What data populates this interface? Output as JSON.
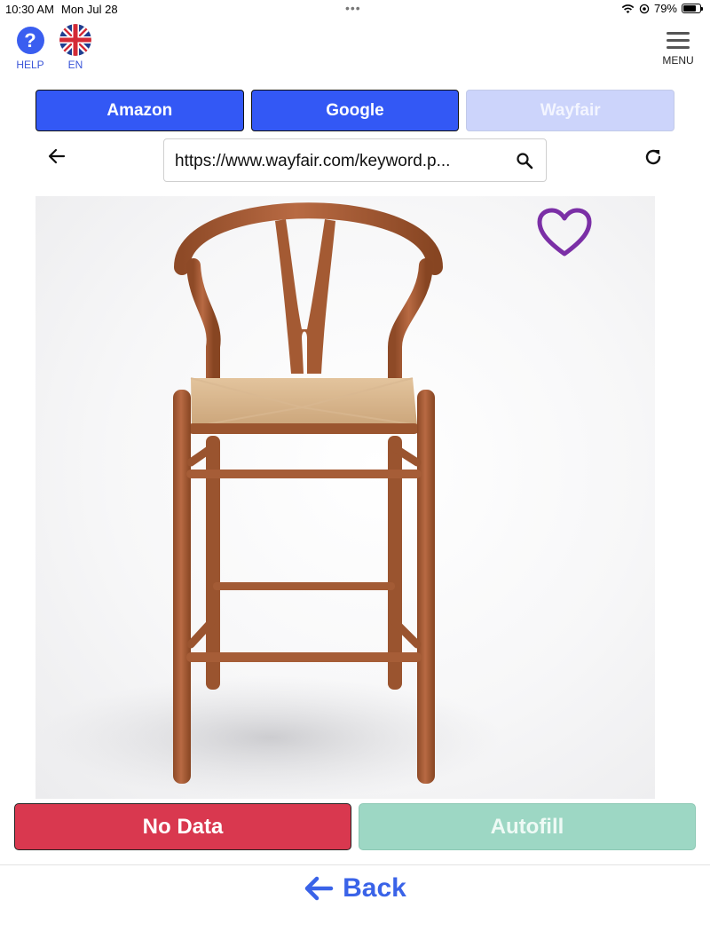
{
  "status_bar": {
    "time": "10:30 AM",
    "date": "Mon Jul 28",
    "battery_percent": "79%",
    "battery_level": 0.79,
    "icons": [
      "wifi-icon",
      "location-lock-icon",
      "battery-icon"
    ]
  },
  "header": {
    "help_label": "HELP",
    "help_symbol": "?",
    "language_label": "EN",
    "menu_label": "MENU"
  },
  "tabs": [
    {
      "label": "Amazon",
      "state": "active"
    },
    {
      "label": "Google",
      "state": "active"
    },
    {
      "label": "Wayfair",
      "state": "disabled"
    }
  ],
  "browser": {
    "url": "https://www.wayfair.com/keyword.p..."
  },
  "product": {
    "favorite_color": "#7b2fa6"
  },
  "actions": {
    "no_data_label": "No Data",
    "autofill_label": "Autofill"
  },
  "footer": {
    "back_label": "Back"
  },
  "colors": {
    "primary_blue": "#3358f5",
    "danger": "#d9384f",
    "autofill": "#9dd7c4"
  }
}
